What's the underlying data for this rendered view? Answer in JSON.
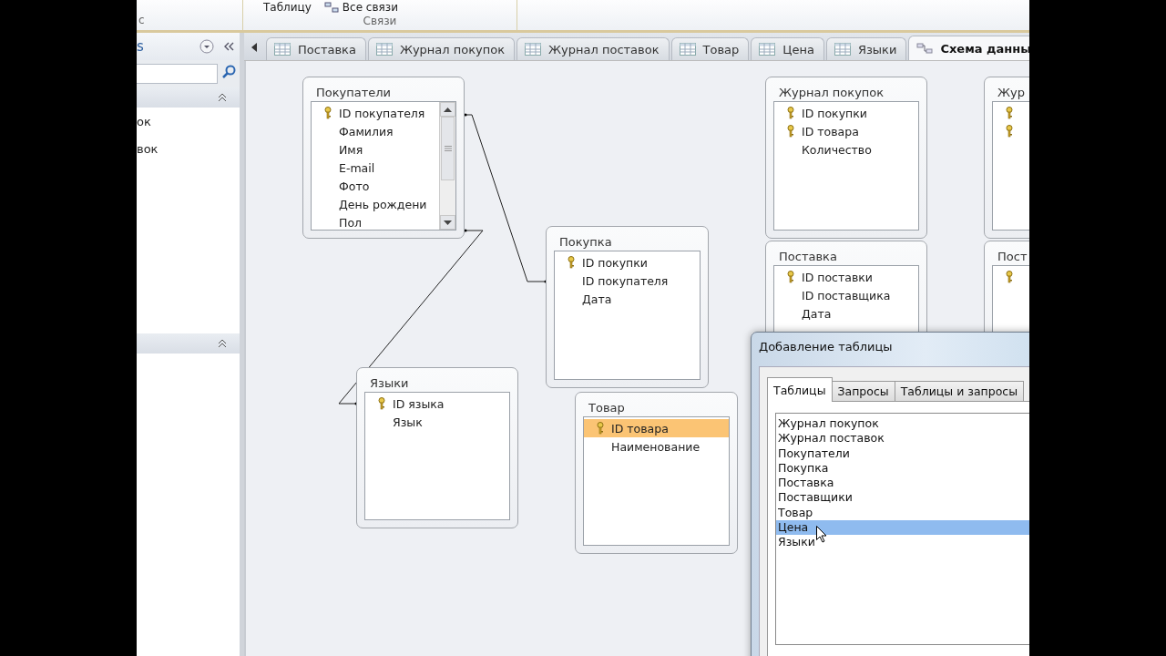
{
  "ribbon": {
    "left_fragment": "с",
    "buttons": [
      {
        "label": "Таблицу",
        "kind": "text"
      },
      {
        "label": "Все связи",
        "kind": "icon"
      }
    ],
    "group_label": "Связи"
  },
  "nav_pane": {
    "title_fragment": "s",
    "items": [
      {
        "label": "ок"
      },
      {
        "label": "вок"
      }
    ]
  },
  "doc_tabs": [
    {
      "label": "Поставка",
      "kind": "table",
      "selected": false
    },
    {
      "label": "Журнал покупок",
      "kind": "table",
      "selected": false
    },
    {
      "label": "Журнал поставок",
      "kind": "table",
      "selected": false
    },
    {
      "label": "Товар",
      "kind": "table",
      "selected": false
    },
    {
      "label": "Цена",
      "kind": "table",
      "selected": false
    },
    {
      "label": "Языки",
      "kind": "table",
      "selected": false
    },
    {
      "label": "Схема данны",
      "kind": "diagram",
      "selected": true
    }
  ],
  "diagram": {
    "tables": [
      {
        "title": "Покупатели",
        "scrollbar": true,
        "fields": [
          {
            "name": "ID покупателя",
            "key": true,
            "selected": false
          },
          {
            "name": "Фамилия",
            "key": false,
            "selected": false
          },
          {
            "name": "Имя",
            "key": false,
            "selected": false
          },
          {
            "name": "E-mail",
            "key": false,
            "selected": false
          },
          {
            "name": "Фото",
            "key": false,
            "selected": false
          },
          {
            "name": "День рождени",
            "key": false,
            "selected": false
          },
          {
            "name": "Пол",
            "key": false,
            "selected": false
          }
        ]
      },
      {
        "title": "Покупка",
        "scrollbar": false,
        "fields": [
          {
            "name": "ID покупки",
            "key": true,
            "selected": false
          },
          {
            "name": "ID покупателя",
            "key": false,
            "selected": false
          },
          {
            "name": "Дата",
            "key": false,
            "selected": false
          }
        ]
      },
      {
        "title": "Языки",
        "scrollbar": false,
        "fields": [
          {
            "name": "ID языка",
            "key": true,
            "selected": false
          },
          {
            "name": "Язык",
            "key": false,
            "selected": false
          }
        ]
      },
      {
        "title": "Товар",
        "scrollbar": false,
        "fields": [
          {
            "name": "ID товара",
            "key": true,
            "selected": true
          },
          {
            "name": "Наименование",
            "key": false,
            "selected": false
          }
        ]
      },
      {
        "title": "Журнал покупок",
        "scrollbar": false,
        "fields": [
          {
            "name": "ID покупки",
            "key": true,
            "selected": false
          },
          {
            "name": "ID товара",
            "key": true,
            "selected": false
          },
          {
            "name": "Количество",
            "key": false,
            "selected": false
          }
        ]
      },
      {
        "title": "Поставка",
        "scrollbar": false,
        "fields": [
          {
            "name": "ID поставки",
            "key": true,
            "selected": false
          },
          {
            "name": "ID поставщика",
            "key": false,
            "selected": false
          },
          {
            "name": "Дата",
            "key": false,
            "selected": false
          }
        ]
      },
      {
        "title": "Жур",
        "scrollbar": false,
        "fields": [
          {
            "key": true,
            "selected": false
          },
          {
            "key": true,
            "selected": false
          }
        ]
      },
      {
        "title": "Пост",
        "scrollbar": false,
        "fields": [
          {
            "key": true,
            "selected": false
          }
        ]
      }
    ]
  },
  "dialog": {
    "title": "Добавление таблицы",
    "tabs": [
      {
        "label": "Таблицы",
        "selected": true
      },
      {
        "label": "Запросы",
        "selected": false
      },
      {
        "label": "Таблицы и запросы",
        "selected": false
      }
    ],
    "items": [
      {
        "label": "Журнал покупок",
        "selected": false
      },
      {
        "label": "Журнал поставок",
        "selected": false
      },
      {
        "label": "Покупатели",
        "selected": false
      },
      {
        "label": "Покупка",
        "selected": false
      },
      {
        "label": "Поставка",
        "selected": false
      },
      {
        "label": "Поставщики",
        "selected": false
      },
      {
        "label": "Товар",
        "selected": false
      },
      {
        "label": "Цена",
        "selected": true
      },
      {
        "label": "Языки",
        "selected": false
      }
    ]
  }
}
